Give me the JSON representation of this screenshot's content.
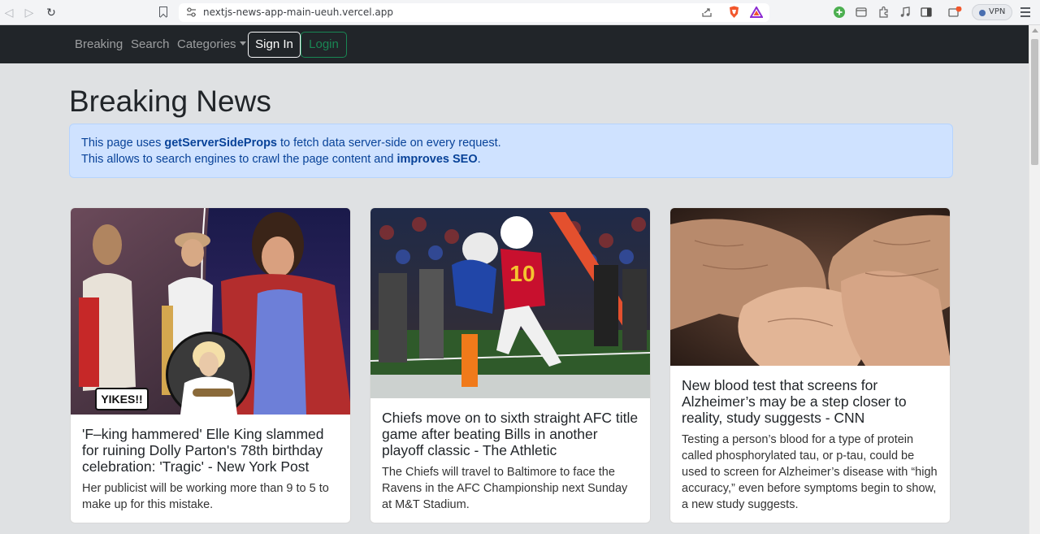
{
  "browser": {
    "url": "nextjs-news-app-main-ueuh.vercel.app",
    "vpn_label": "VPN"
  },
  "navbar": {
    "links": [
      "Breaking",
      "Search",
      "Categories"
    ],
    "signin_label": "Sign In",
    "login_label": "Login"
  },
  "page": {
    "title": "Breaking News",
    "alert": {
      "line1_pre": "This page uses ",
      "line1_bold": "getServerSideProps",
      "line1_post": " to fetch data server-side on every request.",
      "line2_pre": "This allows to search engines to crawl the page content and ",
      "line2_bold": "improves SEO",
      "line2_post": "."
    }
  },
  "articles": [
    {
      "title": "'F–king hammered' Elle King slammed for ruining Dolly Parton's 78th birthday celebration: 'Tragic' - New York Post",
      "description": "Her publicist will be working more than 9 to 5 to make up for this mistake.",
      "image_caption": "YIKES!!"
    },
    {
      "title": "Chiefs move on to sixth straight AFC title game after beating Bills in another playoff classic - The Athletic",
      "description": "The Chiefs will travel to Baltimore to face the Ravens in the AFC Championship next Sunday at M&T Stadium.",
      "jersey_number": "10"
    },
    {
      "title": "New blood test that screens for Alzheimer’s may be a step closer to reality, study suggests - CNN",
      "description": "Testing a person’s blood for a type of protein called phosphorylated tau, or p-tau, could be used to screen for Alzheimer’s disease with “high accuracy,” even before symptoms begin to show, a new study suggests."
    }
  ]
}
